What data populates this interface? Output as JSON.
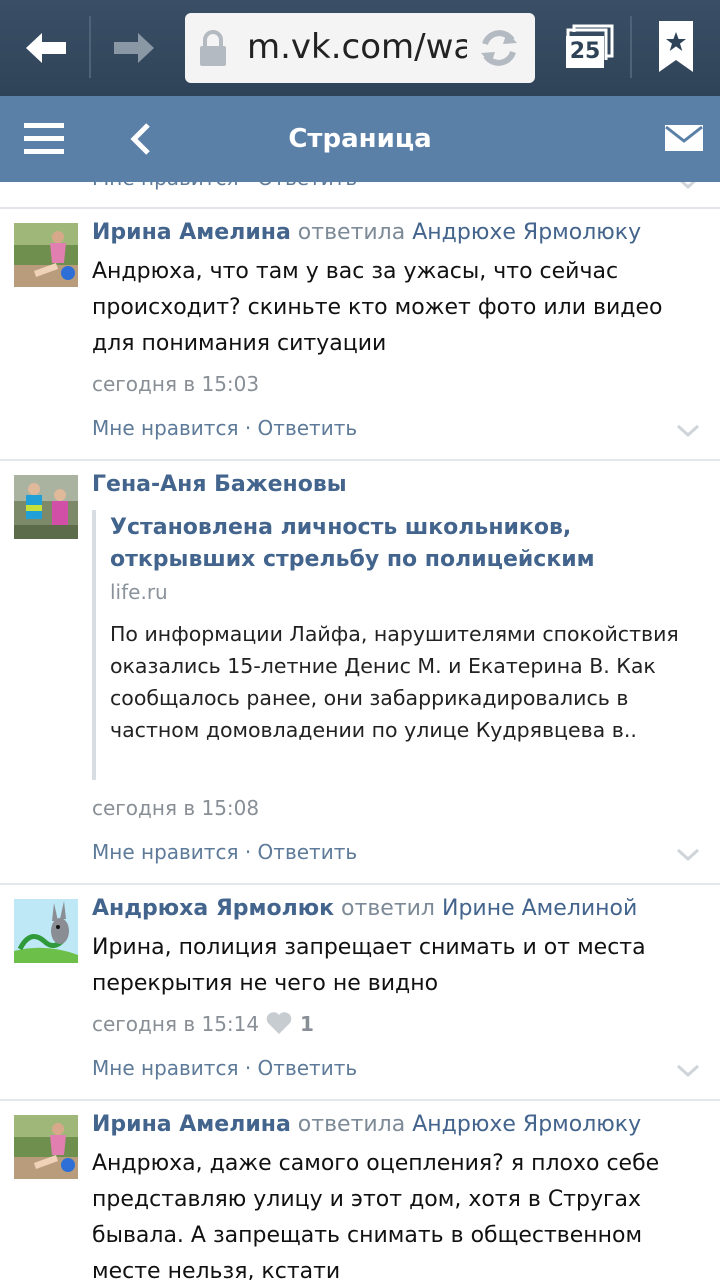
{
  "browser": {
    "url": "m.vk.com/wa",
    "tabs_count": "25"
  },
  "header": {
    "title": "Страница"
  },
  "cut_actions": "Мне нравится · Ответить",
  "comments": [
    {
      "author": "Ирина Амелина",
      "verb": "ответила",
      "target": "Андрюхе Ярмолюку",
      "text": "Андрюха, что там у вас за ужасы, что сейчас происходит? скиньте кто может фото или видео для понимания ситуации",
      "time": "сегодня в 15:03",
      "actions": "Мне нравится · Ответить"
    },
    {
      "author": "Гена-Аня Баженовы",
      "link": {
        "title": "Установлена личность школьников, открывших стрельбу по полицейским",
        "source": "life.ru",
        "text": "По информации Лайфа, нарушителями спокойствия оказались 15-летние Денис М. и Екатерина В. Как сообщалось ранее, они забаррикадировались в частном домовладении по улице Кудрявцева в.."
      },
      "time": "сегодня в 15:08",
      "actions": "Мне нравится · Ответить"
    },
    {
      "author": "Андрюха Ярмолюк",
      "verb": "ответил",
      "target": "Ирине Амелиной",
      "text": "Ирина, полиция запрещает снимать и от места перекрытия не чего не видно",
      "time": "сегодня в 15:14",
      "likes": "1",
      "actions": "Мне нравится · Ответить"
    },
    {
      "author": "Ирина Амелина",
      "verb": "ответила",
      "target": "Андрюхе Ярмолюку",
      "text": "Андрюха, даже самого оцепления? я плохо себе представляю улицу и этот дом, хотя в Стругах бывала. А запрещать снимать в общественном месте нельзя, кстати"
    }
  ],
  "colors": {
    "browser_bar": "#34495e",
    "header": "#5b80a8",
    "link": "#43648c",
    "muted": "#888f96"
  }
}
